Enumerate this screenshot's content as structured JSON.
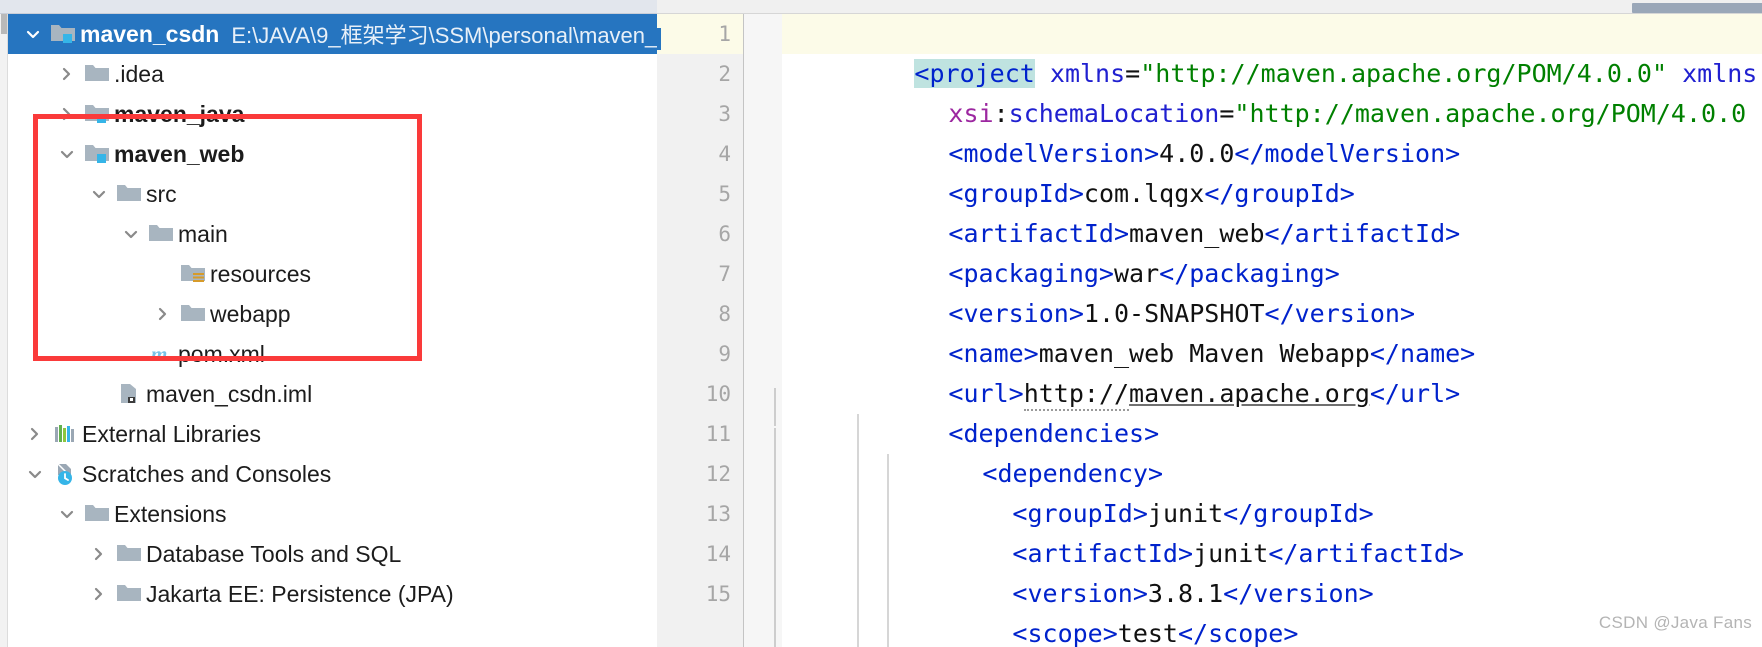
{
  "window": {
    "selected_accent": "#2675c0",
    "highlight_box_color": "#fa3a3a"
  },
  "project_tree": {
    "root": {
      "label": "maven_csdn",
      "path": "E:\\JAVA\\9_框架学习\\SSM\\personal\\maven_",
      "icon": "module-folder-icon",
      "expanded": true,
      "selected": true
    },
    "items": [
      {
        "label": ".idea",
        "icon": "folder-icon",
        "twisty": "collapsed",
        "depth": 1,
        "bold": false
      },
      {
        "label": "maven_java",
        "icon": "module-folder-icon",
        "twisty": "collapsed",
        "depth": 1,
        "bold": true
      },
      {
        "label": "maven_web",
        "icon": "module-folder-icon",
        "twisty": "expanded",
        "depth": 1,
        "bold": true
      },
      {
        "label": "src",
        "icon": "folder-icon",
        "twisty": "expanded",
        "depth": 2,
        "bold": false
      },
      {
        "label": "main",
        "icon": "folder-icon",
        "twisty": "expanded",
        "depth": 3,
        "bold": false
      },
      {
        "label": "resources",
        "icon": "resources-folder-icon",
        "twisty": "none",
        "depth": 4,
        "bold": false
      },
      {
        "label": "webapp",
        "icon": "folder-icon",
        "twisty": "collapsed",
        "depth": 4,
        "bold": false
      },
      {
        "label": "pom.xml",
        "icon": "maven-m-icon",
        "twisty": "none",
        "depth": 3,
        "bold": false
      },
      {
        "label": "maven_csdn.iml",
        "icon": "iml-file-icon",
        "twisty": "none",
        "depth": 2,
        "bold": false
      },
      {
        "label": "External Libraries",
        "icon": "libraries-icon",
        "twisty": "collapsed",
        "depth": 0,
        "bold": false
      },
      {
        "label": "Scratches and Consoles",
        "icon": "scratches-icon",
        "twisty": "expanded",
        "depth": 0,
        "bold": false
      },
      {
        "label": "Extensions",
        "icon": "folder-icon",
        "twisty": "expanded",
        "depth": 1,
        "bold": false
      },
      {
        "label": "Database Tools and SQL",
        "icon": "folder-icon",
        "twisty": "collapsed",
        "depth": 2,
        "bold": false
      },
      {
        "label": "Jakarta EE: Persistence (JPA)",
        "icon": "folder-icon",
        "twisty": "collapsed",
        "depth": 2,
        "bold": false
      }
    ]
  },
  "editor": {
    "line_numbers": [
      "1",
      "2",
      "3",
      "4",
      "5",
      "6",
      "7",
      "8",
      "9",
      "10",
      "11",
      "12",
      "13",
      "14",
      "15"
    ],
    "fold_lines": [
      1,
      10,
      11
    ],
    "current_line": 1,
    "lines": [
      {
        "n": 1,
        "indent": 0,
        "text": "<project xmlns=\"http://maven.apache.org/POM/4.0.0\" xmlns"
      },
      {
        "n": 2,
        "indent": 1,
        "text": "xsi:schemaLocation=\"http://maven.apache.org/POM/4.0.0"
      },
      {
        "n": 3,
        "indent": 1,
        "text": "<modelVersion>4.0.0</modelVersion>"
      },
      {
        "n": 4,
        "indent": 1,
        "text": "<groupId>com.lqgx</groupId>"
      },
      {
        "n": 5,
        "indent": 1,
        "text": "<artifactId>maven_web</artifactId>"
      },
      {
        "n": 6,
        "indent": 1,
        "text": "<packaging>war</packaging>"
      },
      {
        "n": 7,
        "indent": 1,
        "text": "<version>1.0-SNAPSHOT</version>"
      },
      {
        "n": 8,
        "indent": 1,
        "text": "<name>maven_web Maven Webapp</name>"
      },
      {
        "n": 9,
        "indent": 1,
        "text": "<url>http://maven.apache.org</url>"
      },
      {
        "n": 10,
        "indent": 1,
        "text": "<dependencies>"
      },
      {
        "n": 11,
        "indent": 2,
        "text": "<dependency>"
      },
      {
        "n": 12,
        "indent": 3,
        "text": "<groupId>junit</groupId>"
      },
      {
        "n": 13,
        "indent": 3,
        "text": "<artifactId>junit</artifactId>"
      },
      {
        "n": 14,
        "indent": 3,
        "text": "<version>3.8.1</version>"
      },
      {
        "n": 15,
        "indent": 3,
        "text": "<scope>test</scope>"
      }
    ]
  },
  "watermark": {
    "text": "CSDN @Java Fans"
  }
}
